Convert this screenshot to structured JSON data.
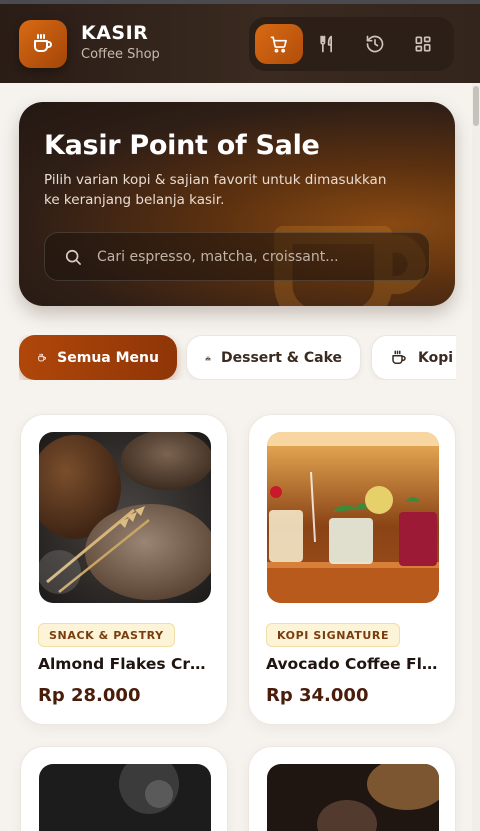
{
  "header": {
    "brand_title": "KASIR",
    "brand_subtitle": "Coffee Shop",
    "logo_icon": "coffee-cup-icon",
    "nav": [
      {
        "icon": "cart-icon",
        "active": true
      },
      {
        "icon": "utensils-icon",
        "active": false
      },
      {
        "icon": "history-icon",
        "active": false
      },
      {
        "icon": "grid-icon",
        "active": false
      }
    ]
  },
  "hero": {
    "title": "Kasir Point of Sale",
    "description": "Pilih varian kopi & sajian favorit untuk dimasukkan ke keranjang belanja kasir.",
    "search_placeholder": "Cari espresso, matcha, croissant..."
  },
  "categories": [
    {
      "label": "Semua Menu",
      "icon": "coffee-cup-icon",
      "active": true
    },
    {
      "label": "Dessert & Cake",
      "icon": "cake-icon",
      "active": false
    },
    {
      "label": "Kopi",
      "icon": "coffee-cup-icon",
      "active": false
    }
  ],
  "products": [
    {
      "category": "SNACK & PASTRY",
      "name": "Almond Flakes Croissant",
      "price": "Rp 28.000"
    },
    {
      "category": "KOPI SIGNATURE",
      "name": "Avocado Coffee Float",
      "price": "Rp 34.000"
    }
  ],
  "colors": {
    "accent": "#c25a0c",
    "header_bg": "#2e2119",
    "price": "#4a1d0a",
    "badge_bg": "#fdf3d6"
  }
}
